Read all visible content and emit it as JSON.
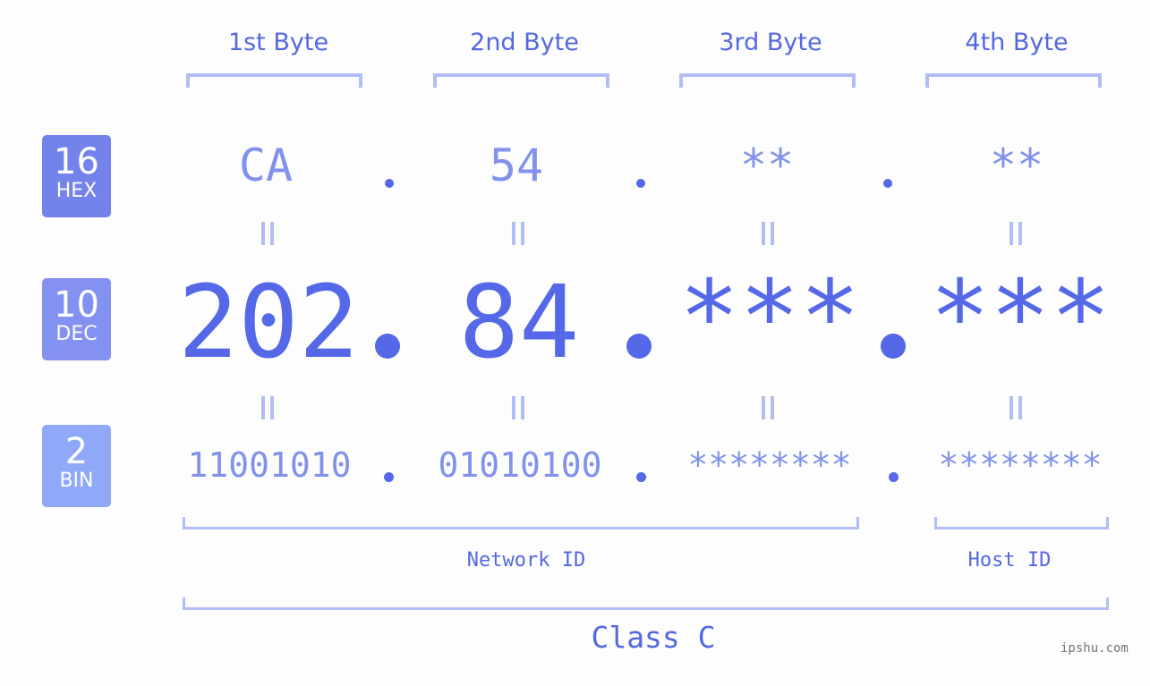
{
  "bytes": [
    {
      "header": "1st Byte",
      "hex": "CA",
      "dec": "202",
      "bin": "11001010"
    },
    {
      "header": "2nd Byte",
      "hex": "54",
      "dec": "84",
      "bin": "01010100"
    },
    {
      "header": "3rd Byte",
      "hex": "**",
      "dec": "***",
      "bin": "********"
    },
    {
      "header": "4th Byte",
      "hex": "**",
      "dec": "***",
      "bin": "********"
    }
  ],
  "badges": {
    "hex": {
      "base": "16",
      "label": "HEX",
      "color": "#7383eb"
    },
    "dec": {
      "base": "10",
      "label": "DEC",
      "color": "#8392f0"
    },
    "bin": {
      "base": "2",
      "label": "BIN",
      "color": "#8fa8f8"
    }
  },
  "labels": {
    "network_id": "Network ID",
    "host_id": "Host ID",
    "ip_class": "Class C"
  },
  "watermark": "ipshu.com",
  "colors": {
    "accent": "#5468e8",
    "light": "#8291ec",
    "bracket": "#b3bdf5"
  }
}
